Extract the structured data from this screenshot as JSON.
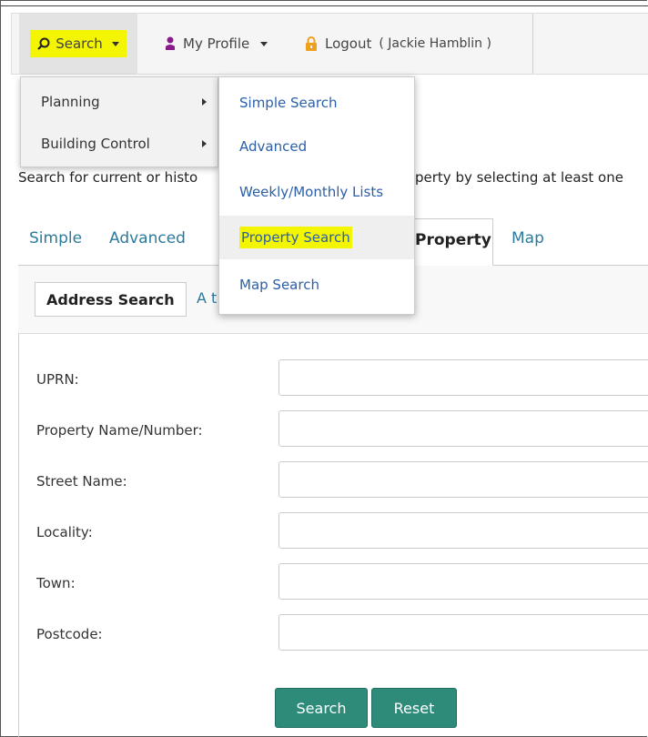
{
  "nav": {
    "search": "Search",
    "profile": "My Profile",
    "logout": "Logout",
    "user": "( Jackie Hamblin )"
  },
  "menu_left": [
    "Planning",
    "Building Control"
  ],
  "menu_right": [
    "Simple Search",
    "Advanced",
    "Weekly/Monthly Lists",
    "Property Search",
    "Map Search"
  ],
  "intro_left": "Search for current or histo",
  "intro_right": "perty by selecting at least one",
  "tabs": {
    "simple": "Simple",
    "advanced": "Advanced",
    "property": "Property",
    "map": "Map"
  },
  "subtabs": {
    "address": "Address Search",
    "other": "A t"
  },
  "fields": {
    "uprn": "UPRN:",
    "property_name": "Property Name/Number:",
    "street": "Street Name:",
    "locality": "Locality:",
    "town": "Town:",
    "postcode": "Postcode:"
  },
  "buttons": {
    "search": "Search",
    "reset": "Reset"
  },
  "colors": {
    "highlight": "#f4f500",
    "link": "#2b5fa8",
    "button": "#2e8b7a"
  }
}
